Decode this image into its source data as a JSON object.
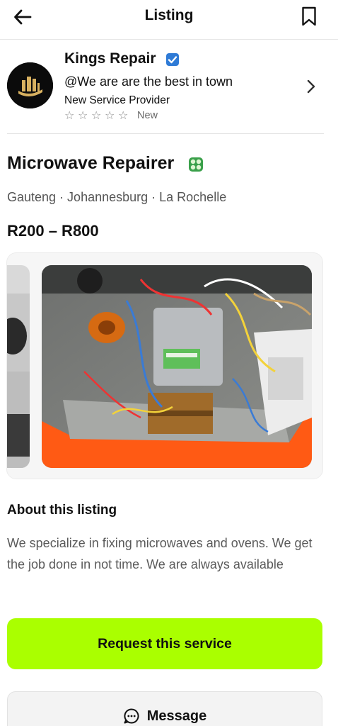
{
  "header": {
    "title": "Listing",
    "back_icon": "arrow-left-icon",
    "bookmark_icon": "bookmark-icon"
  },
  "provider": {
    "name": "Kings Repair",
    "tagline": "@We are are the best in town",
    "status": "New Service Provider",
    "rating": 0,
    "rating_max": 5,
    "rating_label": "New",
    "verified_icon": "verified-badge-icon",
    "avatar_icon": "building-logo-icon"
  },
  "listing": {
    "title": "Microwave Repairer",
    "category_icon": "green-service-icon",
    "location": "Gauteng · Johannesburg · La Rochelle",
    "price": "R200 – R800",
    "photo_subject": "microwave-interior-photo"
  },
  "about": {
    "heading": "About this listing",
    "body": "We specialize in fixing microwaves and ovens. We get the job done in not time. We are always available"
  },
  "actions": {
    "request_label": "Request this service",
    "message_label": "Message"
  },
  "colors": {
    "accent": "#aaff00",
    "verified": "#2f7bd6",
    "category": "#3aa04a"
  }
}
